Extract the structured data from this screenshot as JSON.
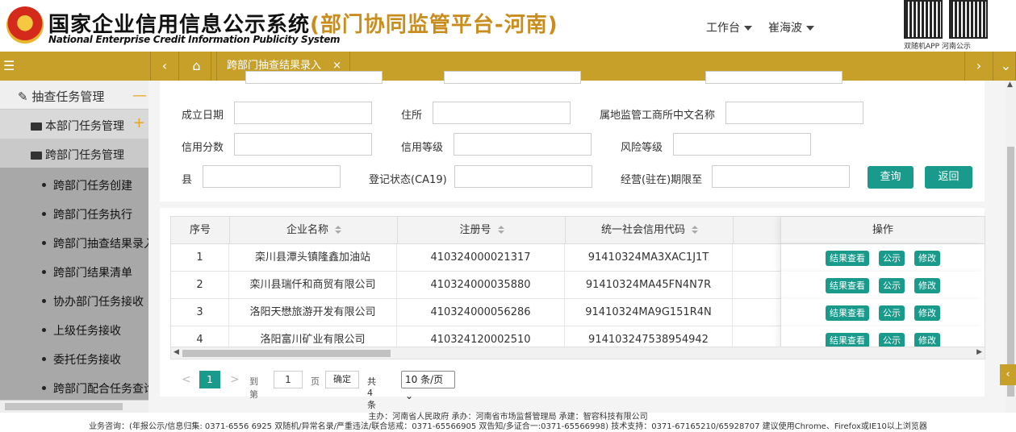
{
  "header": {
    "title_main": "国家企业信用信息公示系统",
    "title_sub": "(部门协同监管平台-河南)",
    "title_en": "National Enterprise Credit Information Publicity System",
    "workbench": "工作台",
    "user": "崔海波",
    "qr_caption": "双随机APP  河南公示"
  },
  "tabbar": {
    "menu_icon": "menu-icon",
    "back_icon": "chevron-left-icon",
    "home_icon": "home-icon",
    "active_tab": "跨部门抽查结果录入",
    "close_icon": "×",
    "forward_icon": "chevron-right-icon",
    "more_icon": "chevron-down-icon"
  },
  "sidebar": {
    "top": "抽查任务管理",
    "groups": [
      {
        "label": "本部门任务管理"
      },
      {
        "label": "跨部门任务管理"
      }
    ],
    "items": [
      {
        "label": "跨部门任务创建"
      },
      {
        "label": "跨部门任务执行"
      },
      {
        "label": "跨部门抽查结果录入"
      },
      {
        "label": "跨部门结果清单"
      },
      {
        "label": "协办部门任务接收"
      },
      {
        "label": "上级任务接收"
      },
      {
        "label": "委托任务接收"
      },
      {
        "label": "跨部门配合任务查询"
      }
    ]
  },
  "form": {
    "row1": {
      "f1": "成立日期",
      "f2": "住所",
      "f3": "属地监管工商所中文名称"
    },
    "row2": {
      "f1": "信用分数",
      "f2": "信用等级",
      "f3": "风险等级"
    },
    "row3": {
      "f1": "县",
      "f2": "登记状态(CA19)",
      "f3": "经营(驻在)期限至"
    },
    "query": "查询",
    "back": "返回"
  },
  "table": {
    "columns": {
      "idx": "序号",
      "name": "企业名称",
      "reg": "注册号",
      "credit": "统一社会信用代码",
      "ops": "操作"
    },
    "rows": [
      {
        "idx": "1",
        "name": "栾川县潭头镇隆鑫加油站",
        "reg": "410324000021317",
        "credit": "91410324MA3XAC1J1T"
      },
      {
        "idx": "2",
        "name": "栾川县瑞仟和商贸有限公司",
        "reg": "410324000035880",
        "credit": "91410324MA45FN4N7R"
      },
      {
        "idx": "3",
        "name": "洛阳天懋旅游开发有限公司",
        "reg": "410324000056286",
        "credit": "91410324MA9G151R4N"
      },
      {
        "idx": "4",
        "name": "洛阳富川矿业有限公司",
        "reg": "410324120002510",
        "credit": "914103247538954942"
      }
    ],
    "op_view": "结果查看",
    "op_publish": "公示",
    "op_edit": "修改"
  },
  "pager": {
    "prev": "<",
    "current": "1",
    "next": ">",
    "goto": "到第",
    "page_input": "1",
    "page_unit": "页",
    "confirm": "确定",
    "total": "共 4 条",
    "page_size": "10 条/页"
  },
  "footer": {
    "line1": "主办：河南省人民政府    承办：河南省市场监督管理局    承建：智容科技有限公司",
    "line2": "业务咨询：(年报公示/信息归集: 0371-6556 6925    双随机/异常名录/严重违法/联合惩戒：0371-65566905    双告知/多证合一:0371-65566998)    技术支持：0371-67165210/65928707    建议使用Chrome、Firefox或IE10以上浏览器"
  },
  "colors": {
    "brand": "#c7a02a",
    "accent": "#1a9a8b"
  }
}
